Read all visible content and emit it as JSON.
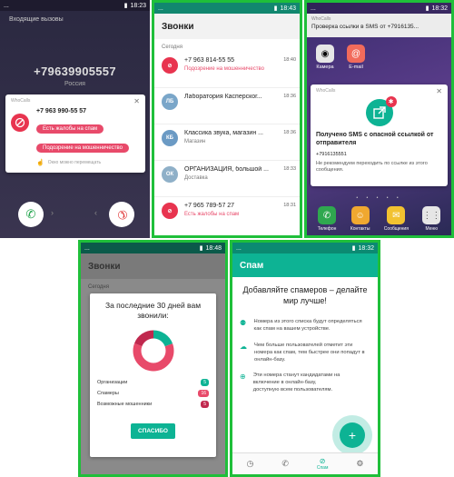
{
  "colors": {
    "brand_green": "#00a88e",
    "accent_green_frame": "#1fbf3a",
    "spam_red": "#e84a6a",
    "dark_bg": "#2d2a3f",
    "light_green": "#0db394"
  },
  "p1": {
    "statusbar": {
      "left": "...",
      "time": "18:23"
    },
    "header": "Входящие вызовы",
    "number": "+79639905557",
    "country": "Россия",
    "app_label": "WhoCalls",
    "card_number": "+7 963 990-55 57",
    "btn_complaint": "Есть жалобы на спам",
    "btn_fraud": "Подозрение на мошенничество",
    "footer_hint": "Окно можно перемещать"
  },
  "p2": {
    "statusbar": {
      "left": "...",
      "time": "18:43"
    },
    "title": "Звонки",
    "section": "Сегодня",
    "rows": [
      {
        "avatar": "",
        "title": "+7 963 814-55 55",
        "sub": "Подозрение на мошенничество",
        "time": "18:40",
        "kind": "fraud"
      },
      {
        "avatar": "ЛБ",
        "title": "Лаборатория Касперског...",
        "sub": "",
        "time": "18:36",
        "kind": "ok"
      },
      {
        "avatar": "КБ",
        "title": "Классика звука, магазин ...",
        "sub": "Магазин",
        "time": "18:36",
        "kind": "ok"
      },
      {
        "avatar": "ОК",
        "title": "ОРГАНИЗАЦИЯ, большой ...",
        "sub": "Доставка",
        "time": "18:33",
        "kind": "ok"
      },
      {
        "avatar": "",
        "title": "+7 965 789-57 27",
        "sub": "Есть жалобы на спам",
        "time": "18:31",
        "kind": "spam"
      }
    ]
  },
  "p3": {
    "statusbar": {
      "left": "...",
      "time": "18:32"
    },
    "notif_app": "WhoCalls",
    "notif_title": "Проверка ссылки в SMS от +7916135...",
    "icon_camera": "Камера",
    "icon_email": "E-mail",
    "card_app": "WhoCalls",
    "card_title": "Получено SMS с опасной ссылкой от отправителя",
    "card_number": "+7916135551",
    "card_text": "Не рекомендуем переходить по ссылке из этого сообщения.",
    "dock": [
      "Телефон",
      "Контакты",
      "Сообщения",
      "Меню"
    ]
  },
  "p4": {
    "statusbar": {
      "left": "...",
      "time": "18:48"
    },
    "title": "Звонки",
    "section": "Сегодня",
    "dialog_title": "За последние 30 дней вам звонили:",
    "legend": [
      {
        "label": "Организации",
        "count": "5",
        "color": "#0db394"
      },
      {
        "label": "Спамеры",
        "count": "16",
        "color": "#e84a6a"
      },
      {
        "label": "Возможные мошенники",
        "count": "5",
        "color": "#c0284e"
      }
    ],
    "button": "СПАСИБО",
    "donut": [
      5,
      16,
      5
    ]
  },
  "p5": {
    "statusbar": {
      "left": "...",
      "time": "18:32"
    },
    "title": "Спам",
    "heading": "Добавляйте спамеров – делайте мир лучше!",
    "items": [
      "Номера из этого списка будут определяться как спам на вашем устройстве.",
      "Чем больше пользователей отметит эти номера как спам, тем быстрее они попадут в онлайн-базу.",
      "Эти номера станут кандидатами на включение в онлайн-базу, доступную всем пользователям."
    ],
    "fab": "+",
    "nav_label": "Спам"
  }
}
